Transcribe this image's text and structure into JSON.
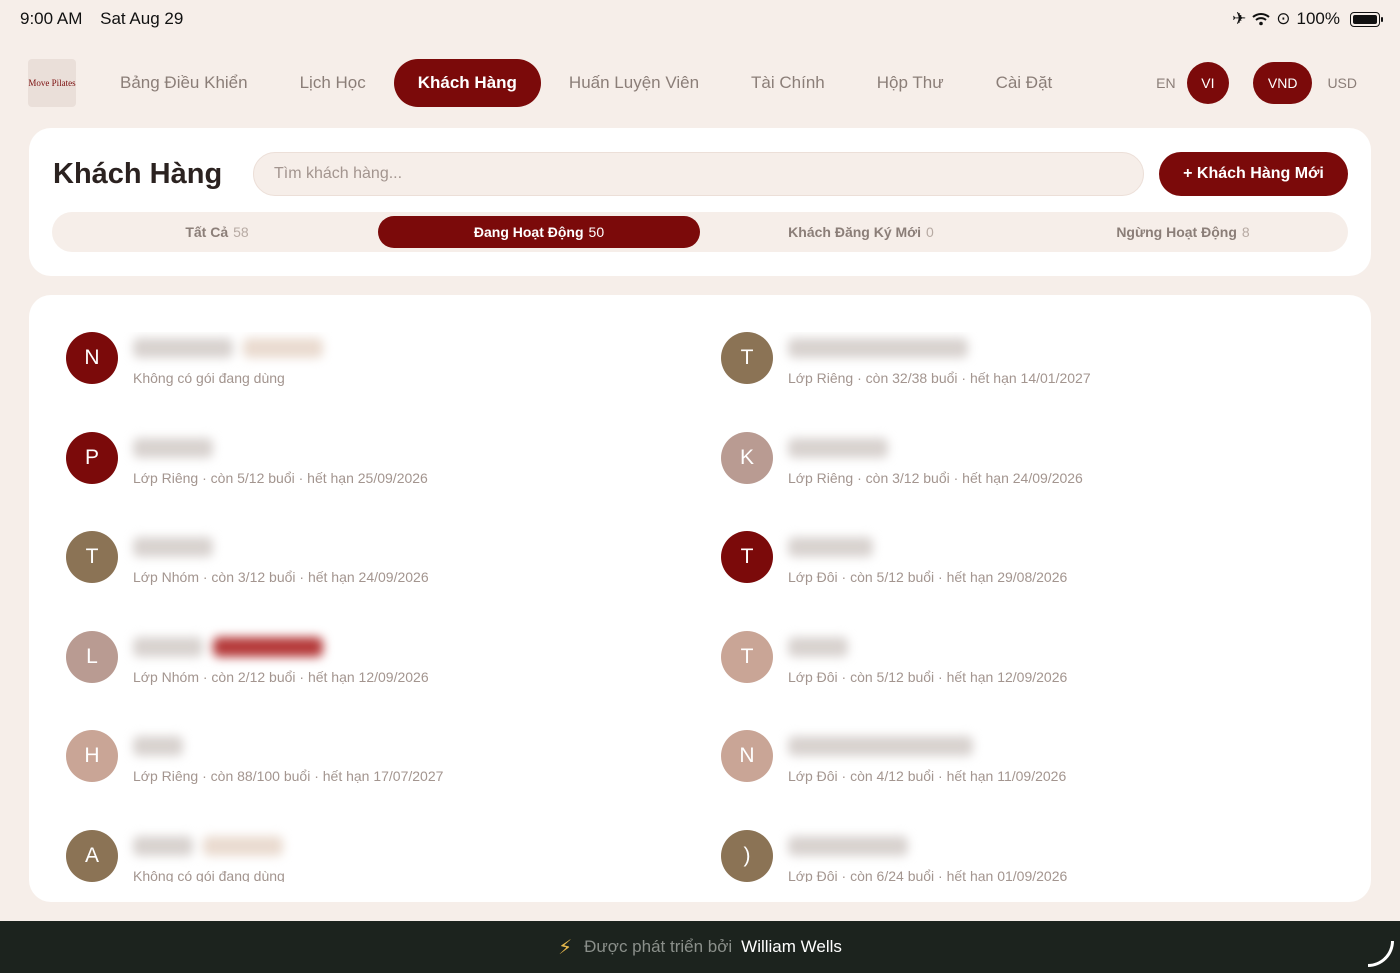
{
  "status": {
    "time": "9:00 AM",
    "date": "Sat Aug 29",
    "battery": "100%"
  },
  "nav": {
    "logo_text": "Move Pilates",
    "items": [
      "Bảng Điều Khiển",
      "Lịch Học",
      "Khách Hàng",
      "Huấn Luyện Viên",
      "Tài Chính",
      "Hộp Thư",
      "Cài Đặt"
    ],
    "active_index": 2,
    "lang": [
      "EN",
      "VI"
    ],
    "lang_active": "VI",
    "currency": [
      "VND",
      "USD"
    ],
    "currency_active": "VND"
  },
  "header": {
    "title": "Khách Hàng",
    "search_placeholder": "Tìm khách hàng...",
    "new_button": "+ Khách Hàng Mới"
  },
  "tabs": [
    {
      "label": "Tất Cả",
      "count": "58"
    },
    {
      "label": "Đang Hoạt Động",
      "count": "50",
      "active": true
    },
    {
      "label": "Khách Đăng Ký Mới",
      "count": "0"
    },
    {
      "label": "Ngừng Hoạt Động",
      "count": "8"
    }
  ],
  "clients": [
    {
      "initial": "N",
      "color": "#7b0a0a",
      "sub": "Không có gói đang dùng"
    },
    {
      "initial": "T",
      "color": "#8b7355",
      "sub": "Lớp Riêng · còn 32/38 buổi · hết hạn 14/01/2027"
    },
    {
      "initial": "P",
      "color": "#7b0a0a",
      "sub": "Lớp Riêng · còn 5/12 buổi · hết hạn 25/09/2026"
    },
    {
      "initial": "K",
      "color": "#b99b92",
      "sub": "Lớp Riêng · còn 3/12 buổi · hết hạn 24/09/2026"
    },
    {
      "initial": "T",
      "color": "#8b7355",
      "sub": "Lớp Nhóm · còn 3/12 buổi · hết hạn 24/09/2026"
    },
    {
      "initial": "T",
      "color": "#7b0a0a",
      "sub": "Lớp Đôi · còn 5/12 buổi · hết hạn 29/08/2026"
    },
    {
      "initial": "L",
      "color": "#b99b92",
      "sub": "Lớp Nhóm · còn 2/12 buổi · hết hạn 12/09/2026"
    },
    {
      "initial": "T",
      "color": "#c9a596",
      "sub": "Lớp Đôi · còn 5/12 buổi · hết hạn 12/09/2026"
    },
    {
      "initial": "H",
      "color": "#c9a596",
      "sub": "Lớp Riêng · còn 88/100 buổi · hết hạn 17/07/2027"
    },
    {
      "initial": "N",
      "color": "#c9a596",
      "sub": "Lớp Đôi · còn 4/12 buổi · hết hạn 11/09/2026"
    },
    {
      "initial": "A",
      "color": "#8b7355",
      "sub": "Không có gói đang dùng"
    },
    {
      "initial": ")",
      "color": "#8b7355",
      "sub": "Lớp Đôi · còn 6/24 buổi · hết hạn 01/09/2026"
    }
  ],
  "footer": {
    "label": "Được phát triển bởi",
    "author": "William Wells"
  },
  "colors": {
    "accent": "#7b0a0a",
    "background": "#f6eee9",
    "footer": "#1c231e"
  }
}
